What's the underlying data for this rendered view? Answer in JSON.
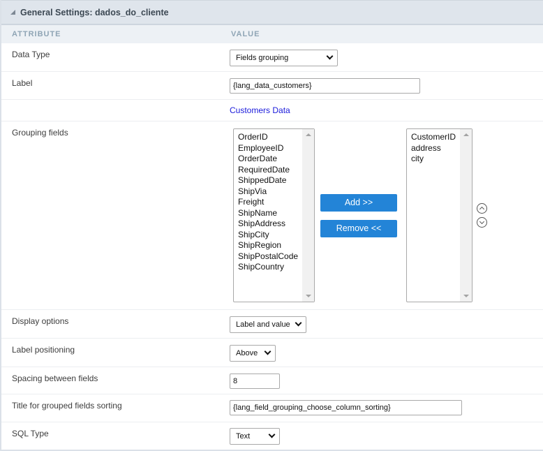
{
  "header": {
    "title": "General Settings: dados_do_cliente",
    "collapse_icon": "triangle-collapse-icon"
  },
  "columns": {
    "attribute": "ATTRIBUTE",
    "value": "VALUE"
  },
  "rows": {
    "data_type": {
      "label": "Data Type",
      "value": "Fields grouping"
    },
    "label": {
      "label": "Label",
      "value": "{lang_data_customers}",
      "preview_link": "Customers Data"
    },
    "grouping_fields": {
      "label": "Grouping fields",
      "available": [
        "OrderID",
        "EmployeeID",
        "OrderDate",
        "RequiredDate",
        "ShippedDate",
        "ShipVia",
        "Freight",
        "ShipName",
        "ShipAddress",
        "ShipCity",
        "ShipRegion",
        "ShipPostalCode",
        "ShipCountry"
      ],
      "selected": [
        "CustomerID",
        "address",
        "city"
      ],
      "add_label": "Add >>",
      "remove_label": "Remove  <<",
      "move_up_icon": "chevron-up-circle-icon",
      "move_down_icon": "chevron-down-circle-icon"
    },
    "display_options": {
      "label": "Display options",
      "value": "Label and value"
    },
    "label_positioning": {
      "label": "Label positioning",
      "value": "Above"
    },
    "spacing": {
      "label": "Spacing between fields",
      "value": "8"
    },
    "sorting_title": {
      "label": "Title for grouped fields sorting",
      "value": "{lang_field_grouping_choose_column_sorting}"
    },
    "sql_type": {
      "label": "SQL Type",
      "value": "Text"
    }
  }
}
